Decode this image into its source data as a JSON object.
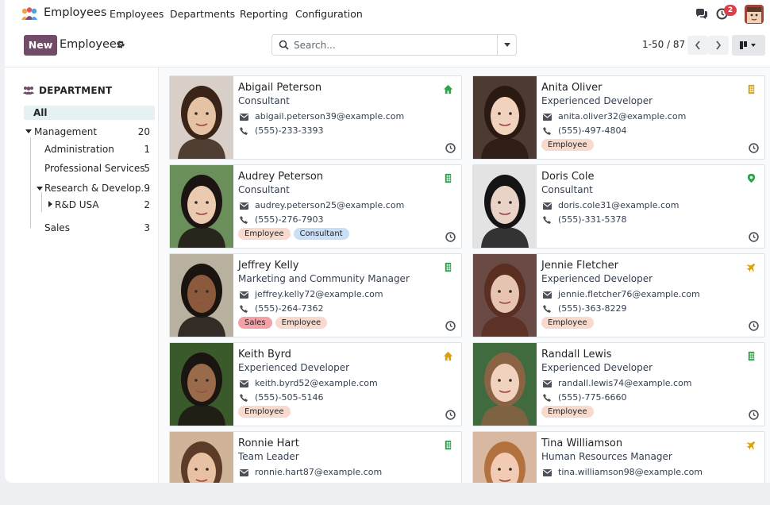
{
  "app": {
    "name": "Employees"
  },
  "nav": {
    "menus": [
      "Employees",
      "Departments",
      "Reporting",
      "Configuration"
    ],
    "activity_badge": "2"
  },
  "control": {
    "new_label": "New",
    "title": "Employees",
    "search_placeholder": "Search...",
    "pager": "1-50 / 87"
  },
  "side": {
    "heading": "DEPARTMENT",
    "all_label": "All",
    "items": [
      {
        "label": "Management",
        "count": "20"
      },
      {
        "label": "Administration",
        "count": "1"
      },
      {
        "label": "Professional Services",
        "count": "5"
      },
      {
        "label": "Research & Develop...",
        "count": "9"
      },
      {
        "label": "R&D USA",
        "count": "2"
      },
      {
        "label": "Sales",
        "count": "3"
      }
    ]
  },
  "colors": {
    "brand": "#714b67",
    "status_green": "#28a745",
    "status_orange": "#d8a20b",
    "tag_employee": "#f7d9cd",
    "tag_consultant": "#c9dff5",
    "tag_sales": "#f3a0a6"
  },
  "employees": [
    {
      "name": "Abigail Peterson",
      "job": "Consultant",
      "email": "abigail.peterson39@example.com",
      "phone": "(555)-233-3393",
      "status_icon": "home-icon",
      "status_color": "#28a745",
      "tags": []
    },
    {
      "name": "Anita Oliver",
      "job": "Experienced Developer",
      "email": "anita.oliver32@example.com",
      "phone": "(555)-497-4804",
      "status_icon": "building-icon",
      "status_color": "#d8a20b",
      "tags": [
        "Employee"
      ]
    },
    {
      "name": "Audrey Peterson",
      "job": "Consultant",
      "email": "audrey.peterson25@example.com",
      "phone": "(555)-276-7903",
      "status_icon": "building-icon",
      "status_color": "#28a745",
      "tags": [
        "Employee",
        "Consultant"
      ]
    },
    {
      "name": "Doris Cole",
      "job": "Consultant",
      "email": "doris.cole31@example.com",
      "phone": "(555)-331-5378",
      "status_icon": "map-marker-icon",
      "status_color": "#28a745",
      "tags": []
    },
    {
      "name": "Jeffrey Kelly",
      "job": "Marketing and Community Manager",
      "email": "jeffrey.kelly72@example.com",
      "phone": "(555)-264-7362",
      "status_icon": "building-icon",
      "status_color": "#28a745",
      "tags": [
        "Sales",
        "Employee"
      ]
    },
    {
      "name": "Jennie Fletcher",
      "job": "Experienced Developer",
      "email": "jennie.fletcher76@example.com",
      "phone": "(555)-363-8229",
      "status_icon": "plane-icon",
      "status_color": "#d8a20b",
      "tags": [
        "Employee"
      ]
    },
    {
      "name": "Keith Byrd",
      "job": "Experienced Developer",
      "email": "keith.byrd52@example.com",
      "phone": "(555)-505-5146",
      "status_icon": "home-icon",
      "status_color": "#d8a20b",
      "tags": [
        "Employee"
      ]
    },
    {
      "name": "Randall Lewis",
      "job": "Experienced Developer",
      "email": "randall.lewis74@example.com",
      "phone": "(555)-775-6660",
      "status_icon": "building-icon",
      "status_color": "#28a745",
      "tags": [
        "Employee"
      ]
    },
    {
      "name": "Ronnie Hart",
      "job": "Team Leader",
      "email": "ronnie.hart87@example.com",
      "phone": "",
      "status_icon": "building-icon",
      "status_color": "#28a745",
      "tags": []
    },
    {
      "name": "Tina Williamson",
      "job": "Human Resources Manager",
      "email": "tina.williamson98@example.com",
      "phone": "",
      "status_icon": "plane-icon",
      "status_color": "#d8a20b",
      "tags": []
    }
  ]
}
